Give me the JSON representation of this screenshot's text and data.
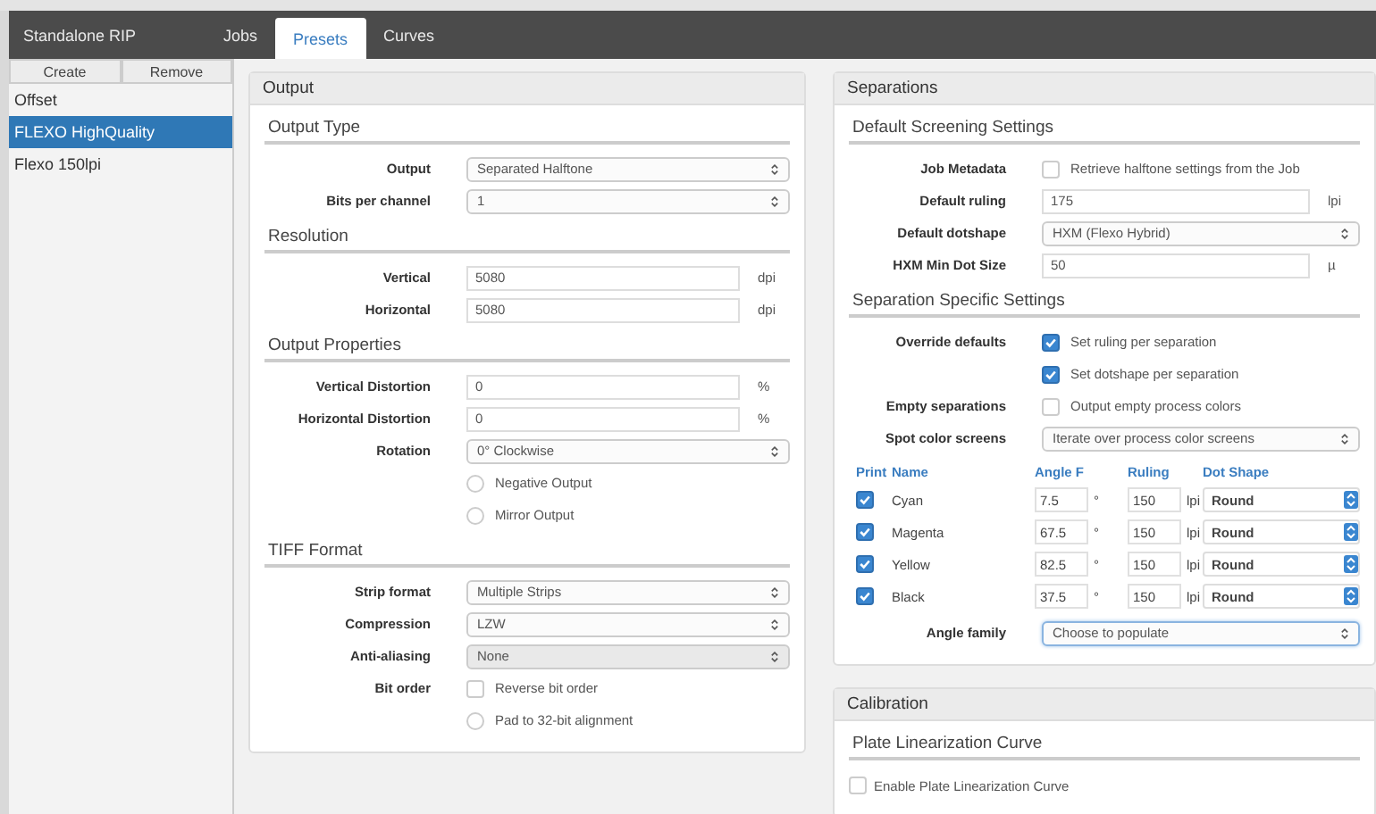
{
  "tabs": [
    {
      "label": "Standalone RIP",
      "selected": false
    },
    {
      "label": "Jobs",
      "selected": false
    },
    {
      "label": "Presets",
      "selected": true
    },
    {
      "label": "Curves",
      "selected": false
    }
  ],
  "sidebar": {
    "buttons": [
      "Create",
      "Remove"
    ],
    "items": [
      {
        "label": "Offset",
        "selected": false
      },
      {
        "label": "FLEXO HighQuality",
        "selected": true
      },
      {
        "label": "Flexo 150lpi",
        "selected": false
      }
    ]
  },
  "output": {
    "title": "Output",
    "sections": [
      {
        "title": "Output Type",
        "fields": [
          {
            "kind": "select",
            "label": "Output",
            "value": "Separated Halftone",
            "disabled": false
          },
          {
            "kind": "select",
            "label": "Bits per channel",
            "value": "1",
            "disabled": false
          }
        ]
      },
      {
        "title": "Resolution",
        "fields": [
          {
            "kind": "input",
            "label": "Vertical",
            "value": "5080",
            "unit": "dpi"
          },
          {
            "kind": "input",
            "label": "Horizontal",
            "value": "5080",
            "unit": "dpi"
          }
        ]
      },
      {
        "title": "Output Properties",
        "fields": [
          {
            "kind": "input",
            "label": "Vertical Distortion",
            "value": "0",
            "unit": "%"
          },
          {
            "kind": "input",
            "label": "Horizontal Distortion",
            "value": "0",
            "unit": "%"
          },
          {
            "kind": "select",
            "label": "Rotation",
            "value": "0° Clockwise",
            "disabled": false
          },
          {
            "kind": "radio",
            "text": "Negative Output",
            "selected": false
          },
          {
            "kind": "radio",
            "text": "Mirror Output",
            "selected": false
          }
        ]
      },
      {
        "title": "TIFF Format",
        "fields": [
          {
            "kind": "select",
            "label": "Strip format",
            "value": "Multiple Strips",
            "disabled": false
          },
          {
            "kind": "select",
            "label": "Compression",
            "value": "LZW",
            "disabled": false
          },
          {
            "kind": "select",
            "label": "Anti-aliasing",
            "value": "None",
            "disabled": true
          },
          {
            "kind": "check",
            "label": "Bit order",
            "text": "Reverse bit order",
            "checked": false
          },
          {
            "kind": "radio",
            "text": "Pad to 32-bit alignment",
            "selected": false
          }
        ]
      }
    ]
  },
  "separations": {
    "title": "Separations",
    "sections": [
      {
        "title": "Default Screening Settings",
        "fields": [
          {
            "kind": "check",
            "label": "Job Metadata",
            "text": "Retrieve halftone settings from the Job",
            "checked": false
          },
          {
            "kind": "input",
            "label": "Default ruling",
            "value": "175",
            "unit": "lpi"
          },
          {
            "kind": "select",
            "label": "Default dotshape",
            "value": "HXM (Flexo Hybrid)",
            "disabled": false
          },
          {
            "kind": "input",
            "label": "HXM Min Dot Size",
            "value": "50",
            "unit": "µ"
          }
        ]
      },
      {
        "title": "Separation Specific Settings",
        "fields": [
          {
            "kind": "check",
            "label": "Override defaults",
            "text": "Set ruling per separation",
            "checked": true
          },
          {
            "kind": "check",
            "text": "Set dotshape per separation",
            "checked": true
          },
          {
            "kind": "check",
            "label": "Empty separations",
            "text": "Output empty process colors",
            "checked": false
          },
          {
            "kind": "select",
            "label": "Spot color screens",
            "value": "Iterate over process color screens",
            "disabled": false
          },
          {
            "kind": "table",
            "columns": [
              "Print",
              "Name",
              "Angle F",
              "Ruling",
              "Dot Shape"
            ],
            "rows": [
              {
                "print": true,
                "name": "Cyan",
                "angle": "7.5",
                "angle_unit": "°",
                "ruling": "150",
                "ruling_unit": "lpi",
                "dot_shape": "Round"
              },
              {
                "print": true,
                "name": "Magenta",
                "angle": "67.5",
                "angle_unit": "°",
                "ruling": "150",
                "ruling_unit": "lpi",
                "dot_shape": "Round"
              },
              {
                "print": true,
                "name": "Yellow",
                "angle": "82.5",
                "angle_unit": "°",
                "ruling": "150",
                "ruling_unit": "lpi",
                "dot_shape": "Round"
              },
              {
                "print": true,
                "name": "Black",
                "angle": "37.5",
                "angle_unit": "°",
                "ruling": "150",
                "ruling_unit": "lpi",
                "dot_shape": "Round"
              }
            ]
          },
          {
            "kind": "select",
            "label": "Angle family",
            "value": "Choose to populate",
            "disabled": false,
            "focused": true
          }
        ]
      }
    ]
  },
  "calibration": {
    "title": "Calibration",
    "sections": [
      {
        "title": "Plate Linearization Curve",
        "fields": [
          {
            "kind": "plain_check",
            "text": "Enable Plate Linearization Curve",
            "checked": false
          }
        ]
      }
    ]
  }
}
